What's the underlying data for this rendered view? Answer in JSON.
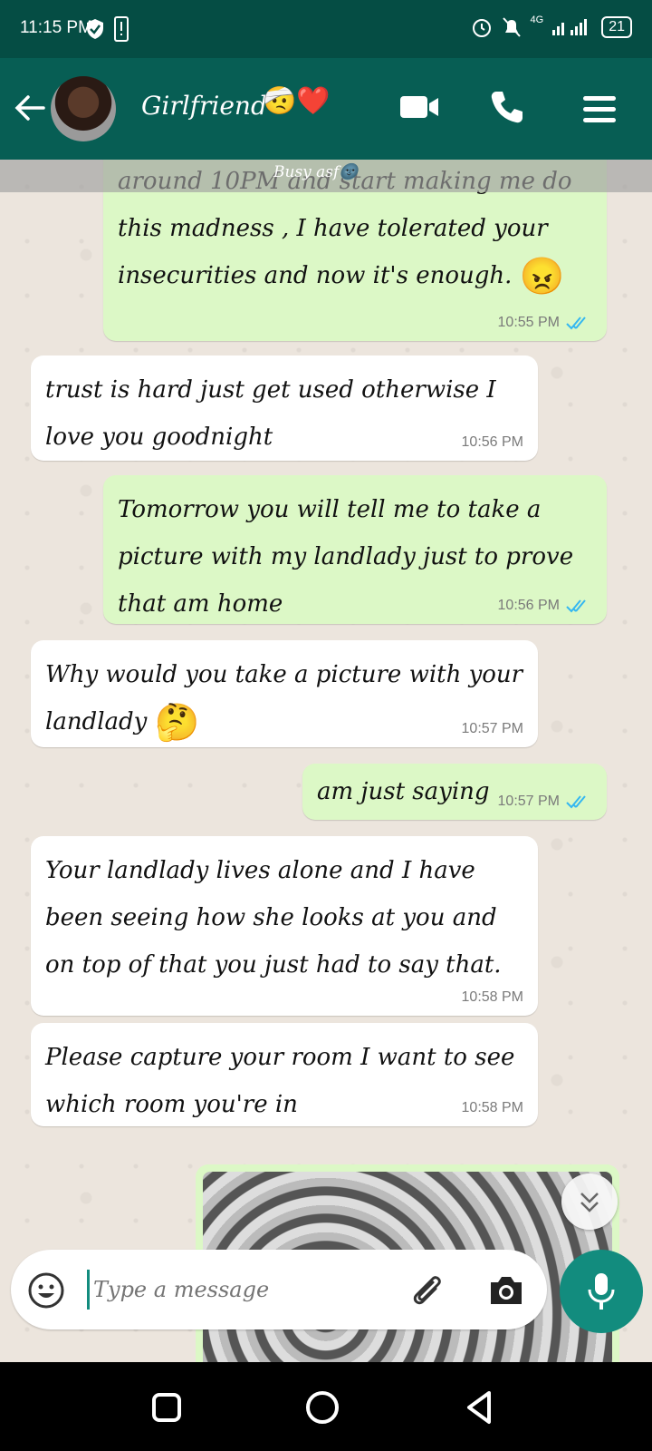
{
  "status_bar": {
    "time": "11:15 PM",
    "network": "4G",
    "battery": "21"
  },
  "header": {
    "contact_name": "Girlfriend",
    "name_emoji": "🤕❤️",
    "icons": [
      "back-arrow-icon",
      "video-call-icon",
      "phone-icon",
      "menu-icon"
    ]
  },
  "overlay": {
    "text": "Busy asf🌚"
  },
  "messages": [
    {
      "direction": "out",
      "text": "around 10PM  and start making me do this madness , I have tolerated your insecurities and now it's enough.",
      "emoji": "😠",
      "time": "10:55 PM",
      "read": true
    },
    {
      "direction": "in",
      "text": "trust is hard just get used otherwise I love you goodnight",
      "time": "10:56 PM"
    },
    {
      "direction": "out",
      "text": "Tomorrow you will tell me to take a picture with my landlady just to prove that am home",
      "time": "10:56 PM",
      "read": true
    },
    {
      "direction": "in",
      "text": "Why would you take a picture with your landlady",
      "emoji": "🤔",
      "time": "10:57 PM"
    },
    {
      "direction": "out",
      "text": "am just saying",
      "time": "10:57 PM",
      "read": true
    },
    {
      "direction": "in",
      "text": "Your landlady lives alone and I have been seeing how she looks at you and on top of that you just had to say that.",
      "time": "10:58 PM"
    },
    {
      "direction": "in",
      "text": "Please capture your room I want to see which room you're in",
      "time": "10:58 PM"
    }
  ],
  "input": {
    "placeholder": "Type a message"
  },
  "colors": {
    "header": "#075e54",
    "status": "#054d44",
    "outgoing": "#dcf8c6",
    "incoming": "#ffffff",
    "accent": "#128c7e",
    "read_ticks": "#34b7f1"
  }
}
